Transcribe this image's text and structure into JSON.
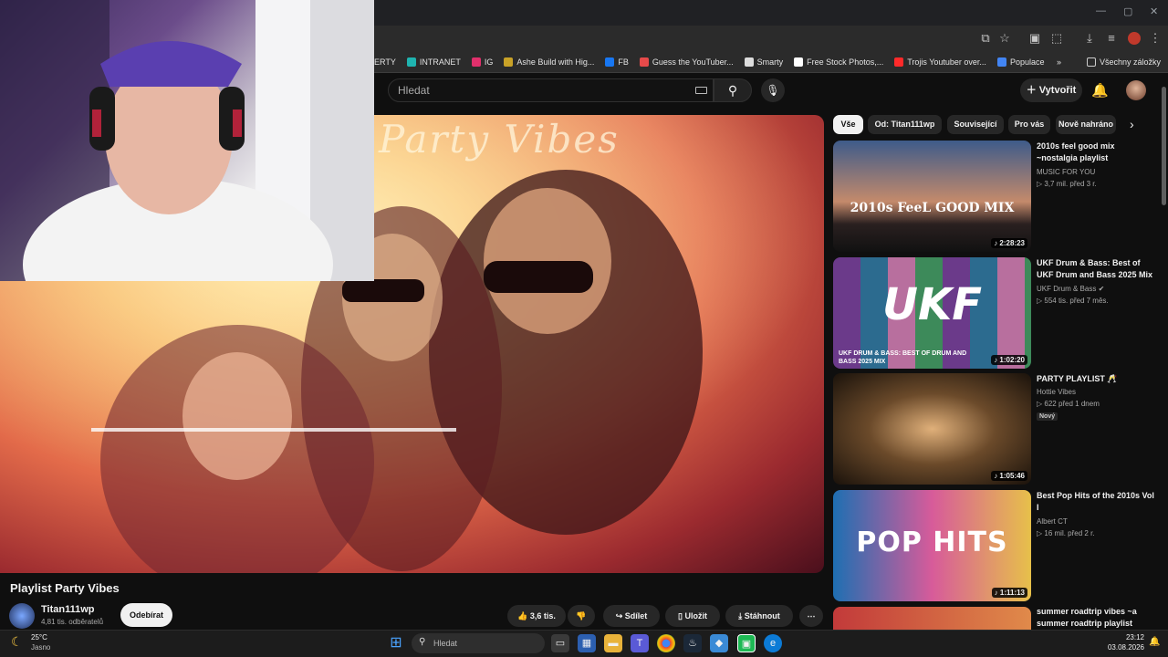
{
  "window": {
    "minimize": "—",
    "maximize": "▢",
    "close": "✕"
  },
  "bookmarks": [
    {
      "label": "ERTY",
      "color": "#2b2b2b"
    },
    {
      "label": "INTRANET",
      "color": "#1fb4b0"
    },
    {
      "label": "IG",
      "color": "#e1306c"
    },
    {
      "label": "Ashe Build with Hig...",
      "color": "#c9a227"
    },
    {
      "label": "FB",
      "color": "#1877f2"
    },
    {
      "label": "Guess the YouTuber...",
      "color": "#e64a4a"
    },
    {
      "label": "Smarty",
      "color": "#dddddd"
    },
    {
      "label": "Free Stock Photos,...",
      "color": "#ffffff"
    },
    {
      "label": "Trojis Youtuber over...",
      "color": "#ff2a2a"
    },
    {
      "label": "Populace",
      "color": "#4285f4"
    }
  ],
  "bookmarks_all": "Všechny záložky",
  "header": {
    "search_placeholder": "Hledat",
    "create": "Vytvořit"
  },
  "video": {
    "art_text": "Party Vibes",
    "title": "Playlist Party Vibes",
    "channel": "Titan111wp",
    "subscribers": "4,81 tis. odběratelů",
    "subscribe": "Odebírat",
    "likes": "3,6 tis.",
    "share": "Sdílet",
    "save": "Uložit",
    "download": "Stáhnout"
  },
  "chips": [
    "Vše",
    "Od: Titan111wp",
    "Související",
    "Pro vás",
    "Nově nahráno"
  ],
  "recommendations": [
    {
      "title": "2010s feel good mix ~nostalgia playlist",
      "channel": "MUSIC FOR YOU",
      "meta": "▷ 3,7 mil.   před 3 r.",
      "duration": "♪ 2:28:23",
      "thumb_text": "2010s FeeL GOOD MIX",
      "verified": false,
      "badge": ""
    },
    {
      "title": "UKF Drum & Bass: Best of UKF Drum and Bass 2025 Mix",
      "channel": "UKF Drum & Bass",
      "meta": "▷ 554 tis.   před 7 měs.",
      "duration": "♪ 1:02:20",
      "thumb_text": "UKF",
      "thumb_sub": "UKF DRUM & BASS: BEST OF DRUM AND BASS 2025 MIX",
      "verified": true,
      "badge": ""
    },
    {
      "title": "PARTY PLAYLIST 🥂",
      "channel": "Hottie Vibes",
      "meta": "▷ 622   před 1 dnem",
      "duration": "♪ 1:05:46",
      "thumb_text": "",
      "verified": false,
      "badge": "Nový"
    },
    {
      "title": "Best Pop Hits of the 2010s Vol I",
      "channel": "Albert CT",
      "meta": "▷ 16 mil.   před 2 r.",
      "duration": "♪ 1:11:13",
      "thumb_text": "POP HITS",
      "verified": false,
      "badge": ""
    },
    {
      "title": "summer roadtrip vibes ~a summer roadtrip playlist",
      "channel": "",
      "meta": "",
      "duration": "",
      "thumb_text": "",
      "verified": false,
      "badge": ""
    }
  ],
  "taskbar": {
    "weather_temp": "25°C",
    "weather_desc": "Jasno",
    "search": "Hledat",
    "time": "23:12",
    "date": "03.08.2026"
  }
}
